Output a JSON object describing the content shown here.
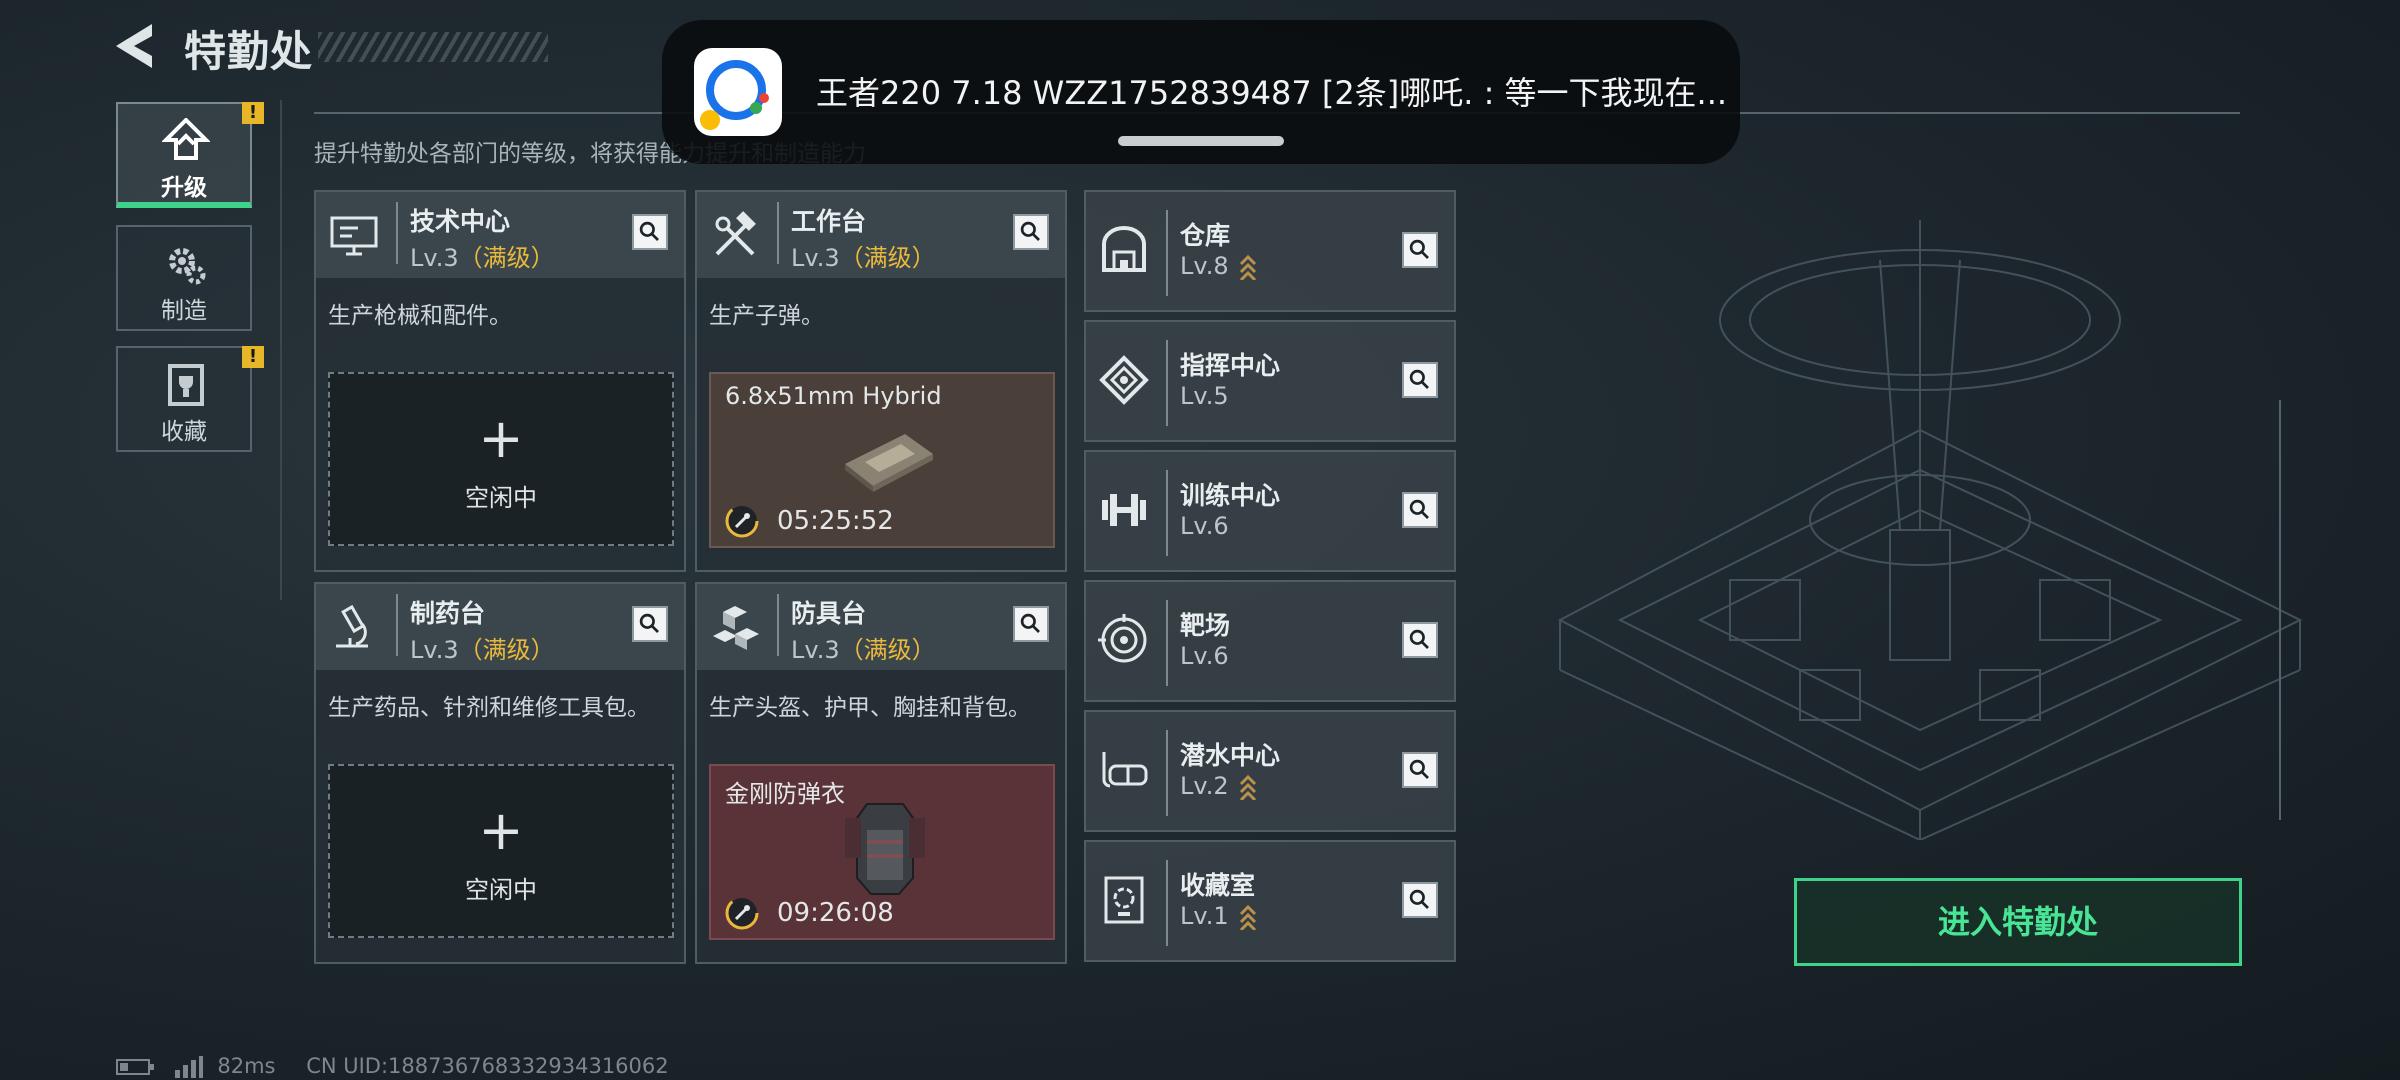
{
  "header": {
    "title": "特勤处",
    "subtitle": "提升特勤处各部门的等级，将获得能力提升和制造能力"
  },
  "nav": [
    {
      "label": "升级",
      "alert": "!"
    },
    {
      "label": "制造",
      "alert": ""
    },
    {
      "label": "收藏",
      "alert": "!"
    }
  ],
  "cards": [
    {
      "name": "技术中心",
      "level": "Lv.3",
      "max": "（满级）",
      "desc": "生产枪械和配件。",
      "status": "空闲中"
    },
    {
      "name": "工作台",
      "level": "Lv.3",
      "max": "（满级）",
      "desc": "生产子弹。",
      "item": "6.8x51mm Hybrid",
      "timer": "05:25:52"
    },
    {
      "name": "制药台",
      "level": "Lv.3",
      "max": "（满级）",
      "desc": "生产药品、针剂和维修工具包。",
      "status": "空闲中"
    },
    {
      "name": "防具台",
      "level": "Lv.3",
      "max": "（满级）",
      "desc": "生产头盔、护甲、胸挂和背包。",
      "item": "金刚防弹衣",
      "timer": "09:26:08"
    }
  ],
  "small_cards": [
    {
      "name": "仓库",
      "level": "Lv.8",
      "upgradable": true
    },
    {
      "name": "指挥中心",
      "level": "Lv.5",
      "upgradable": false
    },
    {
      "name": "训练中心",
      "level": "Lv.6",
      "upgradable": false
    },
    {
      "name": "靶场",
      "level": "Lv.6",
      "upgradable": false
    },
    {
      "name": "潜水中心",
      "level": "Lv.2",
      "upgradable": true
    },
    {
      "name": "收藏室",
      "level": "Lv.1",
      "upgradable": true
    }
  ],
  "enter_button": "进入特勤处",
  "footer": {
    "ping": "82ms",
    "uid": "CN UID:18873676833293431606​2"
  },
  "notification": {
    "text": "王者220 7.18   WZZ1752839487   [2条]哪吒. : 等一下我现在..."
  },
  "colors": {
    "accent_green": "#3fd28b",
    "max_level": "#e9b83c",
    "alert": "#e7b728"
  }
}
